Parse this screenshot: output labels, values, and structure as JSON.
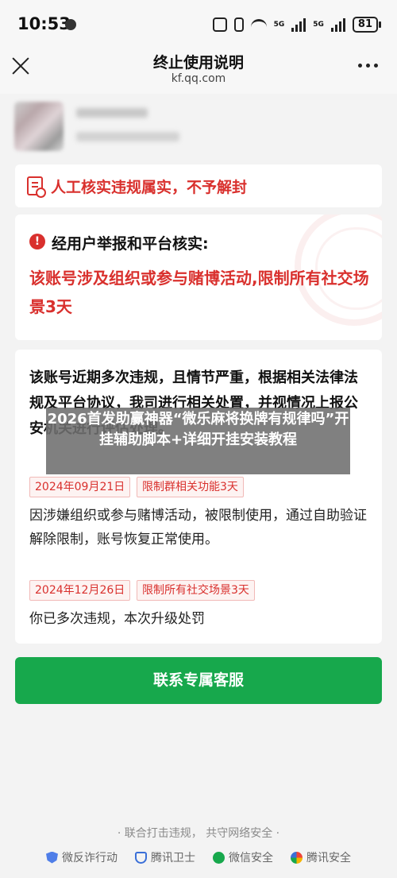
{
  "status_bar": {
    "time": "10:53",
    "network_1": "5G",
    "network_2": "5G",
    "battery": "81"
  },
  "nav": {
    "title": "终止使用说明",
    "subtitle": "kf.qq.com"
  },
  "ban_card": {
    "title": "人工核实违规属实，不予解封"
  },
  "report_card": {
    "heading": "经用户举报和平台核实:",
    "body": "该账号涉及组织或参与赌博活动,限制所有社交场景3天"
  },
  "detail_card": {
    "text": "该账号近期多次违规，且情节严重，根据相关法律法规及平台协议，我司进行相关处置，并视情况上报公安机关进行评估处理。",
    "records": [
      {
        "date": "2024年09月21日",
        "restriction": "限制群相关功能3天",
        "description": "因涉嫌组织或参与赌博活动，被限制使用，通过自助验证解除限制，账号恢复正常使用。"
      },
      {
        "date": "2024年12月26日",
        "restriction": "限制所有社交场景3天",
        "description": "你已多次违规，本次升级处罚"
      }
    ]
  },
  "cta": {
    "label": "联系专属客服"
  },
  "overlay": {
    "text": "2026首发助赢神器“微乐麻将换牌有规律吗”开挂辅助脚本+详细开挂安装教程"
  },
  "footer": {
    "slogan": "· 联合打击违规， 共守网络安全 ·",
    "links": [
      {
        "label": "微反诈行动",
        "icon": "shield-icon"
      },
      {
        "label": "腾讯卫士",
        "icon": "guard-icon"
      },
      {
        "label": "微信安全",
        "icon": "wechat-icon"
      },
      {
        "label": "腾讯安全",
        "icon": "tencent-icon"
      }
    ]
  },
  "colors": {
    "alert_red": "#d9302d",
    "cta_green": "#17a84c",
    "background": "#f3f3f3"
  }
}
